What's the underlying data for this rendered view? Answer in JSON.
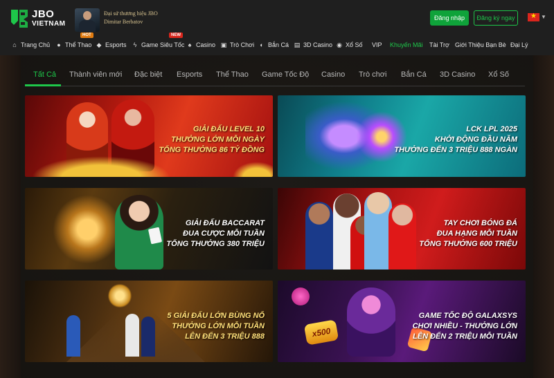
{
  "header": {
    "logo_text_1": "JBO",
    "logo_text_2": "VIETNAM",
    "ambassador_line_1": "Đại sứ thương hiệu JBO",
    "ambassador_line_2": "Dimitar Berbatov",
    "login_label": "Đăng nhập",
    "register_label": "Đăng ký ngay",
    "accent_color": "#1ec74a"
  },
  "nav": {
    "items": [
      {
        "label": "Trang Chủ",
        "icon": "home-icon"
      },
      {
        "label": "Thể Thao",
        "icon": "soccer-ball-icon"
      },
      {
        "label": "Esports",
        "icon": "gamepad-icon"
      },
      {
        "label": "Game Siêu Tốc",
        "icon": "lightning-icon"
      },
      {
        "label": "Casino",
        "icon": "cards-icon"
      },
      {
        "label": "Trò Chơi",
        "icon": "slot-machine-icon"
      },
      {
        "label": "Bắn Cá",
        "icon": "fish-icon"
      },
      {
        "label": "3D Casino",
        "icon": "cube-icon"
      },
      {
        "label": "Xổ Số",
        "icon": "lottery-ball-icon"
      },
      {
        "label": "VIP",
        "icon": ""
      },
      {
        "label": "Khuyến Mãi",
        "icon": ""
      },
      {
        "label": "Tài Trợ",
        "icon": ""
      },
      {
        "label": "Giới Thiệu Bạn Bè",
        "icon": ""
      },
      {
        "label": "Đại Lý",
        "icon": ""
      }
    ],
    "hot_badge": "HOT",
    "new_badge": "NEW"
  },
  "tabs": [
    "Tất Cả",
    "Thành viên mới",
    "Đặc biệt",
    "Esports",
    "Thể Thao",
    "Game Tốc Độ",
    "Casino",
    "Trò chơi",
    "Bắn Cá",
    "3D Casino",
    "Xổ Số"
  ],
  "promos": [
    {
      "lines": [
        "GIẢI ĐẤU LEVEL 10",
        "THƯỞNG LỚN MỖI NGÀY",
        "TỔNG THƯỞNG 86 TỶ ĐỒNG"
      ]
    },
    {
      "lines": [
        "LCK LPL 2025",
        "KHỞI ĐỘNG ĐẦU NĂM",
        "THƯỞNG ĐẾN 3 TRIỆU 888 NGÀN"
      ]
    },
    {
      "lines": [
        "GIẢI ĐẤU BACCARAT",
        "ĐUA CƯỢC MỖI TUẦN",
        "TỔNG THƯỞNG 380 TRIỆU"
      ]
    },
    {
      "lines": [
        "TAY CHƠI BÓNG ĐÁ",
        "ĐUA HẠNG MỖI TUẦN",
        "TỔNG THƯỞNG 600 TRIỆU"
      ]
    },
    {
      "lines": [
        "5 GIẢI ĐẤU LỚN BÙNG NỔ",
        "THƯỞNG LỚN MỖI TUẦN",
        "LÊN ĐẾN 3 TRIỆU 888"
      ]
    },
    {
      "lines": [
        "GAME TỐC ĐỘ GALAXSYS",
        "CHƠI NHIỀU - THƯỞNG LỚN",
        "LÊN ĐẾN 2 TRIỆU MỖI TUẦN"
      ]
    }
  ],
  "promo_extra": {
    "x500": "x500"
  }
}
